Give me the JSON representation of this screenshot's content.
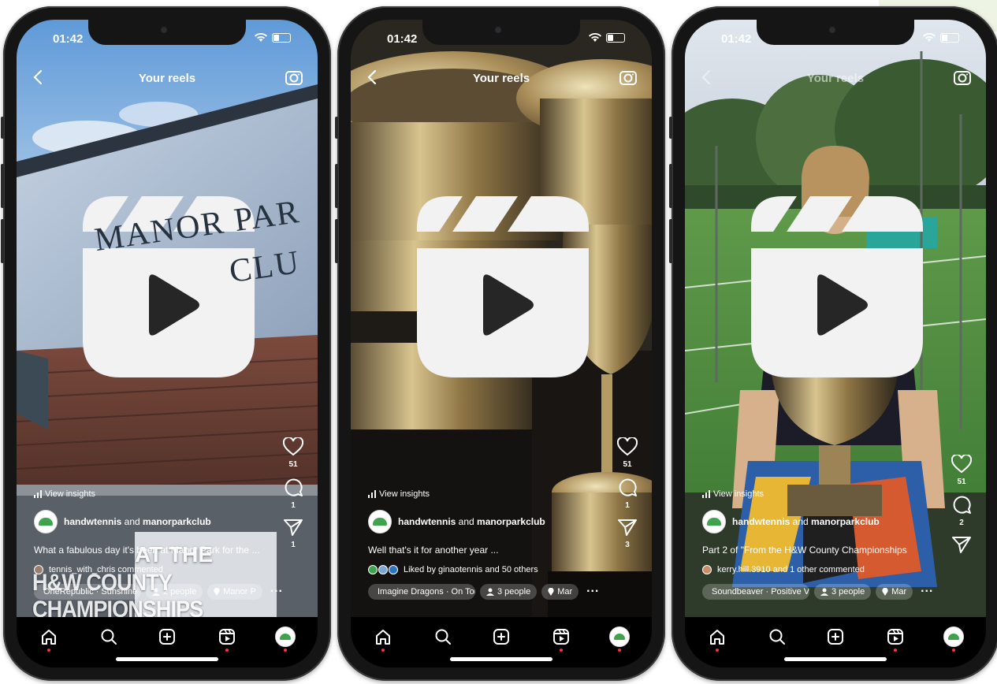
{
  "phones": [
    {
      "time": "01:42",
      "header": "Your reels",
      "likes": "51",
      "comments": "1",
      "shares": "1",
      "insights": "View insights",
      "user_a": "handwtennis",
      "user_join": " and ",
      "user_b": "manorparkclub",
      "caption": "What a fabulous day it's been at Manor Park for the ...",
      "social": "tennis_with_chris commented",
      "music": "OneRepublic · Sunshine",
      "people": "2 people",
      "location": "Manor P",
      "sign_line1": "MANOR PAR",
      "sign_line2": "CLU",
      "overlay_line1": "AT THE",
      "overlay_line2": "H&W COUNTY CHAMPIONSHIPS"
    },
    {
      "time": "01:42",
      "header": "Your reels",
      "likes": "51",
      "comments": "1",
      "shares": "3",
      "insights": "View insights",
      "user_a": "handwtennis",
      "user_join": " and ",
      "user_b": "manorparkclub",
      "caption": "Well that's it for another year ...",
      "social": "Liked by ginaotennis and 50 others",
      "music": "Imagine Dragons · On Top Of",
      "people": "3 people",
      "location": "Mar"
    },
    {
      "time": "01:42",
      "header": "Your reels",
      "likes": "51",
      "comments": "2",
      "shares": "",
      "insights": "View insights",
      "user_a": "handwtennis",
      "user_join": " and ",
      "user_b": "manorparkclub",
      "caption": "Part 2 of \"From the H&W County Championships",
      "social": "kerry.hill.3910 and 1 other commented",
      "music": "Soundbeaver · Positive Vibe",
      "people": "3 people",
      "location": "Mar"
    }
  ],
  "colors": {
    "notification": "#ff3040",
    "logo": "#f2f2f2",
    "brand_green": "#3fa34d"
  },
  "icons": [
    "back-icon",
    "camera-icon",
    "heart-icon",
    "comment-icon",
    "share-icon",
    "music-icon",
    "person-icon",
    "location-icon",
    "home-icon",
    "search-icon",
    "create-icon",
    "reels-icon",
    "profile-icon",
    "reels-logo-icon",
    "insights-icon",
    "wifi-icon",
    "battery-icon"
  ]
}
